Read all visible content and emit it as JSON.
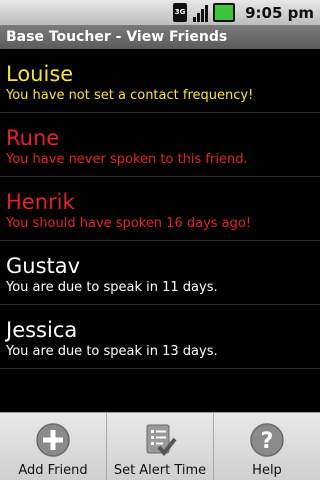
{
  "status_bar": {
    "network": "3G",
    "icons": [
      "3g-icon",
      "signal-icon",
      "battery-icon"
    ],
    "time": "9:05 pm"
  },
  "title": "Base Toucher - View Friends",
  "colors": {
    "yellow": "#f5e53a",
    "red": "#e0242a",
    "white": "#ffffff"
  },
  "friends": [
    {
      "name": "Louise",
      "status": "You have not set a contact frequency!",
      "color": "#f5e53a"
    },
    {
      "name": "Rune",
      "status": "You have never spoken to this friend.",
      "color": "#e0242a"
    },
    {
      "name": "Henrik",
      "status": "You should have spoken 16 days ago!",
      "color": "#e0242a"
    },
    {
      "name": "Gustav",
      "status": "You are due to speak in 11 days.",
      "color": "#ffffff"
    },
    {
      "name": "Jessica",
      "status": "You are due to speak in 13 days.",
      "color": "#ffffff"
    }
  ],
  "menu": [
    {
      "label": "Add Friend",
      "icon": "add-icon"
    },
    {
      "label": "Set Alert Time",
      "icon": "checklist-icon"
    },
    {
      "label": "Help",
      "icon": "help-icon"
    }
  ]
}
